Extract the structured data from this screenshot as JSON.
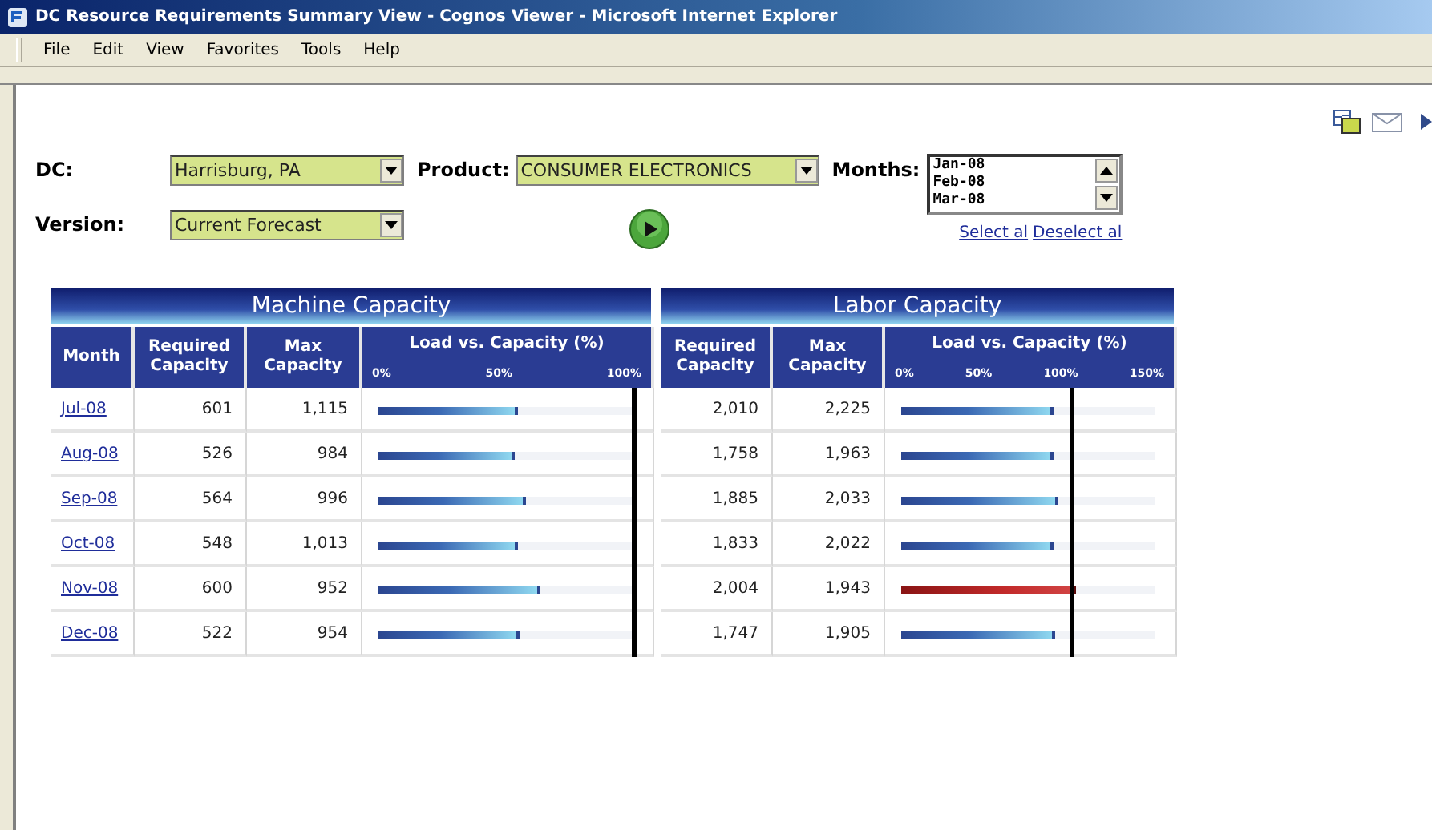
{
  "window": {
    "title": "DC Resource Requirements Summary View - Cognos Viewer - Microsoft Internet Explorer"
  },
  "menu": [
    {
      "label": "File"
    },
    {
      "label": "Edit"
    },
    {
      "label": "View"
    },
    {
      "label": "Favorites"
    },
    {
      "label": "Tools"
    },
    {
      "label": "Help"
    }
  ],
  "filters": {
    "dc": {
      "label": "DC:",
      "value": "Harrisburg, PA"
    },
    "version": {
      "label": "Version:",
      "value": "Current Forecast"
    },
    "product": {
      "label": "Product:",
      "value": "CONSUMER ELECTRONICS"
    },
    "months": {
      "label": "Months:",
      "items": [
        "Jan-08",
        "Feb-08",
        "Mar-08"
      ],
      "links": [
        "Select al",
        "Deselect al"
      ]
    }
  },
  "report": {
    "groups": [
      "Machine Capacity",
      "Labor Capacity"
    ],
    "columns": [
      "Month",
      "Required Capacity",
      "Max Capacity",
      "Load vs. Capacity (%)",
      "Required Capacity",
      "Max Capacity",
      "Load vs. Capacity (%)"
    ],
    "machine_ticks": [
      "0%",
      "50%",
      "100%"
    ],
    "labor_ticks": [
      "0%",
      "50%",
      "100%",
      "150%"
    ],
    "rows": [
      {
        "month": "Jul-08",
        "machine_required": "601",
        "machine_max": "1,115",
        "machine_load": {
          "level": 0.55,
          "over": false
        },
        "labor_required": "2,010",
        "labor_max": "2,225",
        "labor_load": {
          "level": 0.6,
          "over": false
        }
      },
      {
        "month": "Aug-08",
        "machine_required": "526",
        "machine_max": "984",
        "machine_load": {
          "level": 0.54,
          "over": false
        },
        "labor_required": "1,758",
        "labor_max": "1,963",
        "labor_load": {
          "level": 0.6,
          "over": false
        }
      },
      {
        "month": "Sep-08",
        "machine_required": "564",
        "machine_max": "996",
        "machine_load": {
          "level": 0.58,
          "over": false
        },
        "labor_required": "1,885",
        "labor_max": "2,033",
        "labor_load": {
          "level": 0.62,
          "over": false
        }
      },
      {
        "month": "Oct-08",
        "machine_required": "548",
        "machine_max": "1,013",
        "machine_load": {
          "level": 0.55,
          "over": false
        },
        "labor_required": "1,833",
        "labor_max": "2,022",
        "labor_load": {
          "level": 0.6,
          "over": false
        }
      },
      {
        "month": "Nov-08",
        "machine_required": "600",
        "machine_max": "952",
        "machine_load": {
          "level": 0.64,
          "over": false
        },
        "labor_required": "2,004",
        "labor_max": "1,943",
        "labor_load": {
          "level": 0.69,
          "over": true
        }
      },
      {
        "month": "Dec-08",
        "machine_required": "522",
        "machine_max": "954",
        "machine_load": {
          "level": 0.56,
          "over": false
        },
        "labor_required": "1,747",
        "labor_max": "1,905",
        "labor_load": {
          "level": 0.61,
          "over": false
        }
      }
    ]
  }
}
